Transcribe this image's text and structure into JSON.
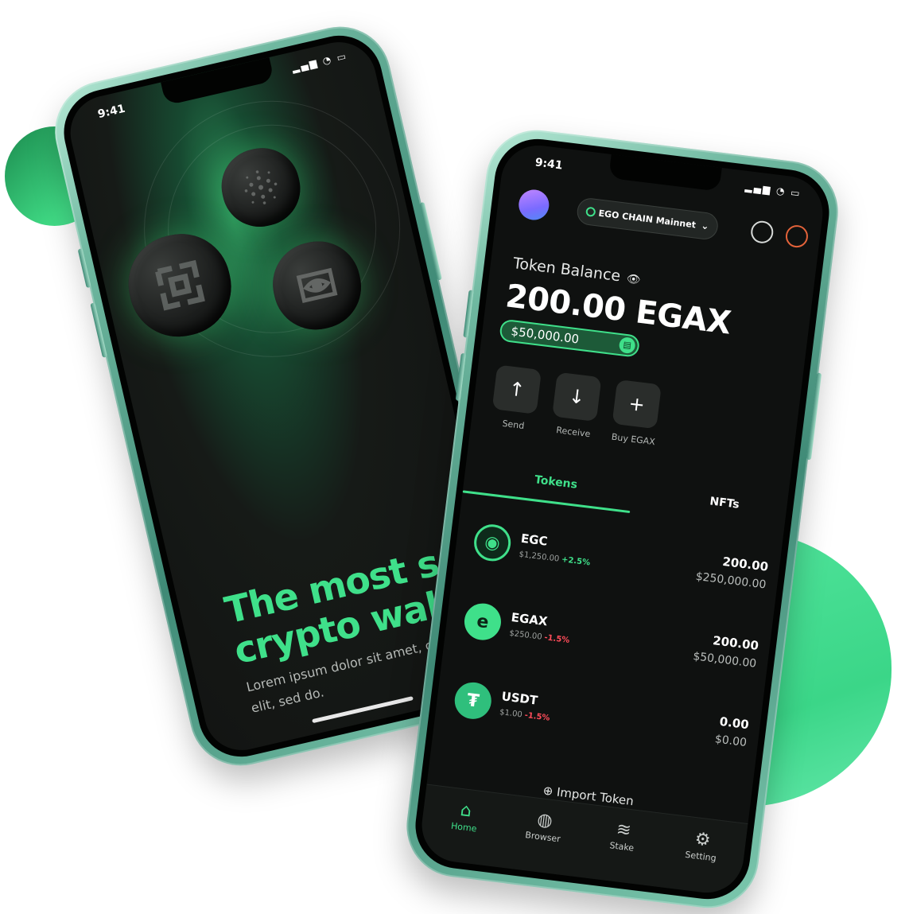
{
  "left_phone": {
    "status_time": "9:41",
    "hero_title": "The most secu\ncrypto wallet",
    "hero_subtitle": "Lorem ipsum dolor sit amet, conse adipiscing elit, sed do."
  },
  "right_phone": {
    "status_time": "9:41",
    "network": "EGO CHAIN Mainnet",
    "balance_label": "Token Balance",
    "balance_value": "200.00 EGAX",
    "balance_usd": "$50,000.00",
    "actions": [
      {
        "label": "Send",
        "icon": "arrow-up-icon"
      },
      {
        "label": "Receive",
        "icon": "arrow-down-icon"
      },
      {
        "label": "Buy EGAX",
        "icon": "plus-icon"
      }
    ],
    "tabs": [
      "Tokens",
      "NFTs"
    ],
    "tokens": [
      {
        "symbol": "EGC",
        "price": "$1,250.00",
        "change": "+2.5%",
        "amount": "200.00",
        "value": "$250,000.00",
        "color": "#3fe08a"
      },
      {
        "symbol": "EGAX",
        "price": "$250.00",
        "change": "-1.5%",
        "amount": "200.00",
        "value": "$50,000.00",
        "color": "#3fe08a"
      },
      {
        "symbol": "USDT",
        "price": "$1.00",
        "change": "-1.5%",
        "amount": "0.00",
        "value": "$0.00",
        "color": "#2fbf7c"
      }
    ],
    "import_label": "⊕ Import Token",
    "nav": [
      {
        "label": "Home",
        "icon": "home-icon"
      },
      {
        "label": "Browser",
        "icon": "globe-icon"
      },
      {
        "label": "Stake",
        "icon": "stake-icon"
      },
      {
        "label": "Setting",
        "icon": "gear-icon"
      }
    ]
  },
  "colors": {
    "accent": "#3fe08a",
    "negative": "#ff4c5a",
    "screen_bg": "#0f1110"
  }
}
